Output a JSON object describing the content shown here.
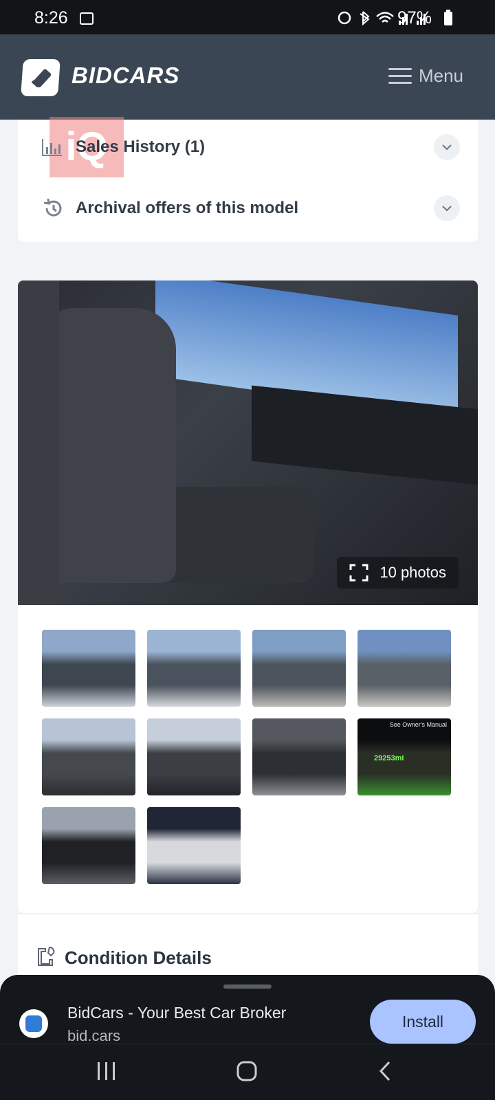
{
  "status_bar": {
    "time": "8:26",
    "battery": "97%",
    "icons": [
      "gallery-icon",
      "alarm-icon",
      "bluetooth-icon",
      "wifi-icon",
      "signal-icon",
      "signal-icon",
      "battery-icon"
    ]
  },
  "header": {
    "logo_text": "BIDCARS",
    "menu_label": "Menu"
  },
  "accordion": {
    "items": [
      {
        "label": "Sales History (1)",
        "icon": "bar-chart-icon"
      },
      {
        "label": "Archival offers of this model",
        "icon": "history-icon"
      }
    ],
    "watermark": "iQ"
  },
  "gallery": {
    "photo_count_label": "10 photos",
    "thumbnails": [
      {
        "subject": "front-left-damaged",
        "colors": [
          "#8fa7c8",
          "#3e4650",
          "#cdd3da"
        ]
      },
      {
        "subject": "front-right-damaged",
        "colors": [
          "#9cb4d4",
          "#4a525d",
          "#d6d9dd"
        ]
      },
      {
        "subject": "rear-right",
        "colors": [
          "#7f9ec6",
          "#4d545d",
          "#bfbcb6"
        ]
      },
      {
        "subject": "rear-left",
        "colors": [
          "#6f90c0",
          "#5a6068",
          "#c9c7c2"
        ]
      },
      {
        "subject": "interior-front-seat",
        "colors": [
          "#b6c4d6",
          "#45484d",
          "#2c2e31"
        ]
      },
      {
        "subject": "interior-rear-seat",
        "colors": [
          "#c6cfd9",
          "#3b3e43",
          "#23252a"
        ]
      },
      {
        "subject": "engine-bay",
        "colors": [
          "#55595f",
          "#2c2f33",
          "#8c9196"
        ]
      },
      {
        "subject": "odometer",
        "colors": [
          "#0c0d0f",
          "#2a2f26",
          "#3b8f2e"
        ]
      },
      {
        "subject": "dashboard",
        "colors": [
          "#9aa3ad",
          "#1f2125",
          "#5a5e64"
        ]
      },
      {
        "subject": "vin-label",
        "colors": [
          "#202635",
          "#d7d9dc",
          "#2b3244"
        ]
      }
    ],
    "odometer_text": "29253mi",
    "odometer_caption": "See Owner's Manual"
  },
  "condition": {
    "title": "Condition Details"
  },
  "install_banner": {
    "title": "BidCars - Your Best Car Broker",
    "url": "bid.cars",
    "button_label": "Install"
  },
  "colors": {
    "header_bg": "#3a4654",
    "install_button": "#aac4ff",
    "page_bg": "#f1f3f6"
  }
}
